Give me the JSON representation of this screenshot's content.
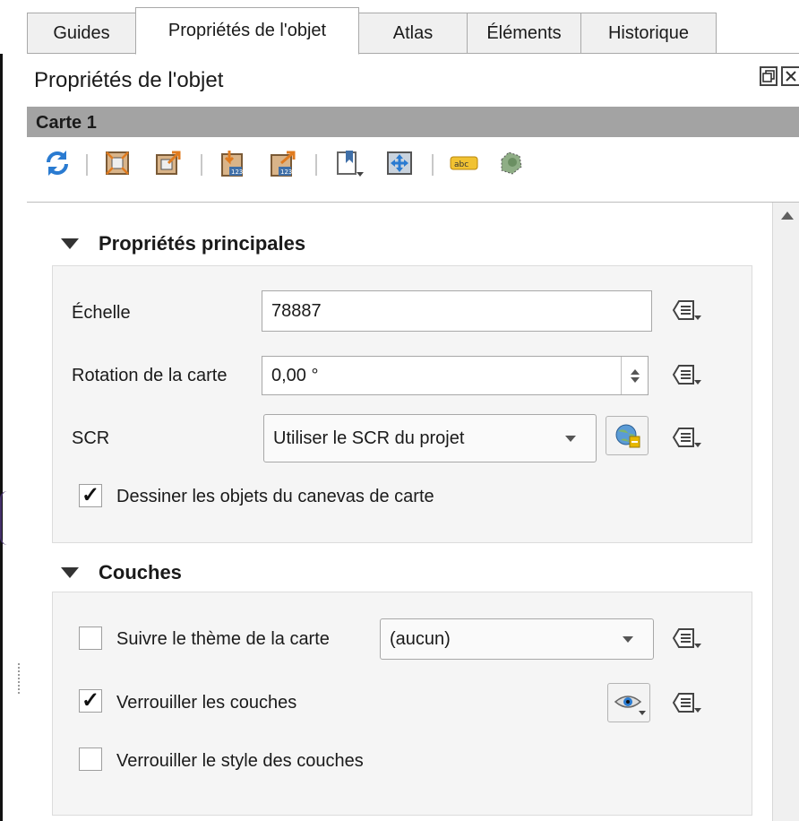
{
  "tabs": [
    {
      "label": "Guides",
      "active": false
    },
    {
      "label": "Propriétés de l'objet",
      "active": true
    },
    {
      "label": "Atlas",
      "active": false
    },
    {
      "label": "Éléments",
      "active": false
    },
    {
      "label": "Historique",
      "active": false
    }
  ],
  "panel": {
    "title": "Propriétés de l'objet",
    "item_name": "Carte 1"
  },
  "toolbar": {
    "icons": [
      "refresh-icon",
      "set-extent-icon",
      "view-extent-icon",
      "set-scale-icon",
      "view-scale-icon",
      "bookmark-icon",
      "move-content-icon",
      "label-icon",
      "clip-icon"
    ]
  },
  "main_group": {
    "title": "Propriétés principales",
    "scale_label": "Échelle",
    "scale_value": "78887",
    "rotation_label": "Rotation de la carte",
    "rotation_value": "0,00 °",
    "crs_label": "SCR",
    "crs_value": "Utiliser le SCR du projet",
    "draw_items_label": "Dessiner les objets du canevas de carte",
    "draw_items_checked": true
  },
  "layers_group": {
    "title": "Couches",
    "follow_theme_label": "Suivre le thème de la carte",
    "follow_theme_checked": false,
    "theme_value": "(aucun)",
    "lock_layers_label": "Verrouiller les couches",
    "lock_layers_checked": true,
    "lock_styles_label": "Verrouiller le style des couches",
    "lock_styles_checked": false
  },
  "colors": {
    "header_bar": "#a3a3a3",
    "group_bg": "#f5f5f5",
    "accent_orange": "#e07b1f",
    "accent_blue": "#2a7bd1"
  }
}
